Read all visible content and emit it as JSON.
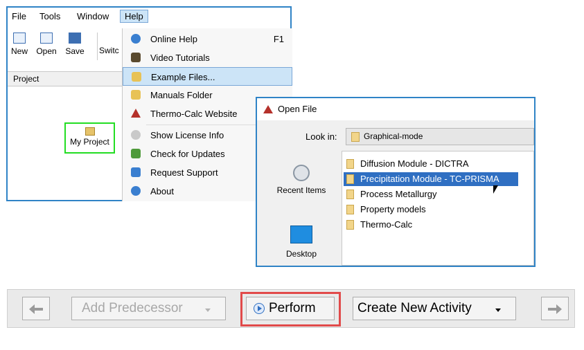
{
  "main_window": {
    "menus": [
      "File",
      "Tools",
      "Window",
      "Help"
    ],
    "toolbar": {
      "new_label": "New",
      "open_label": "Open",
      "save_label": "Save",
      "switch_label": "Switc"
    },
    "project_panel_title": "Project",
    "project_node_label": "My Project"
  },
  "help_menu": {
    "items": [
      {
        "label": "Online Help",
        "shortcut": "F1",
        "icon": "help-circle-icon"
      },
      {
        "label": "Video Tutorials",
        "icon": "film-icon"
      },
      {
        "label": "Example Files...",
        "icon": "folder-open-icon"
      },
      {
        "label": "Manuals Folder",
        "icon": "folder-icon"
      },
      {
        "label": "Thermo-Calc Website",
        "icon": "thermo-calc-logo-icon"
      },
      {
        "label": "Show License Info",
        "icon": "license-icon"
      },
      {
        "label": "Check for Updates",
        "icon": "update-icon"
      },
      {
        "label": "Request Support",
        "icon": "support-icon"
      },
      {
        "label": "About",
        "icon": "info-icon"
      }
    ]
  },
  "open_file_dialog": {
    "title": "Open File",
    "look_in_label": "Look in:",
    "look_in_value": "Graphical-mode",
    "places": [
      "Recent Items",
      "Desktop"
    ],
    "files": [
      "Diffusion Module - DICTRA",
      "Precipitation Module - TC-PRISMA",
      "Process Metallurgy",
      "Property models",
      "Thermo-Calc"
    ],
    "selected_index": 1
  },
  "bottom_toolbar": {
    "add_predecessor_label": "Add Predecessor",
    "perform_label": "Perform",
    "create_new_activity_label": "Create New Activity"
  },
  "colors": {
    "window_border": "#2f83c6",
    "highlight": "#cce4f7",
    "selection": "#2f6fc2",
    "node_outline": "#22dd22",
    "annotation_red": "#e14a4a"
  }
}
